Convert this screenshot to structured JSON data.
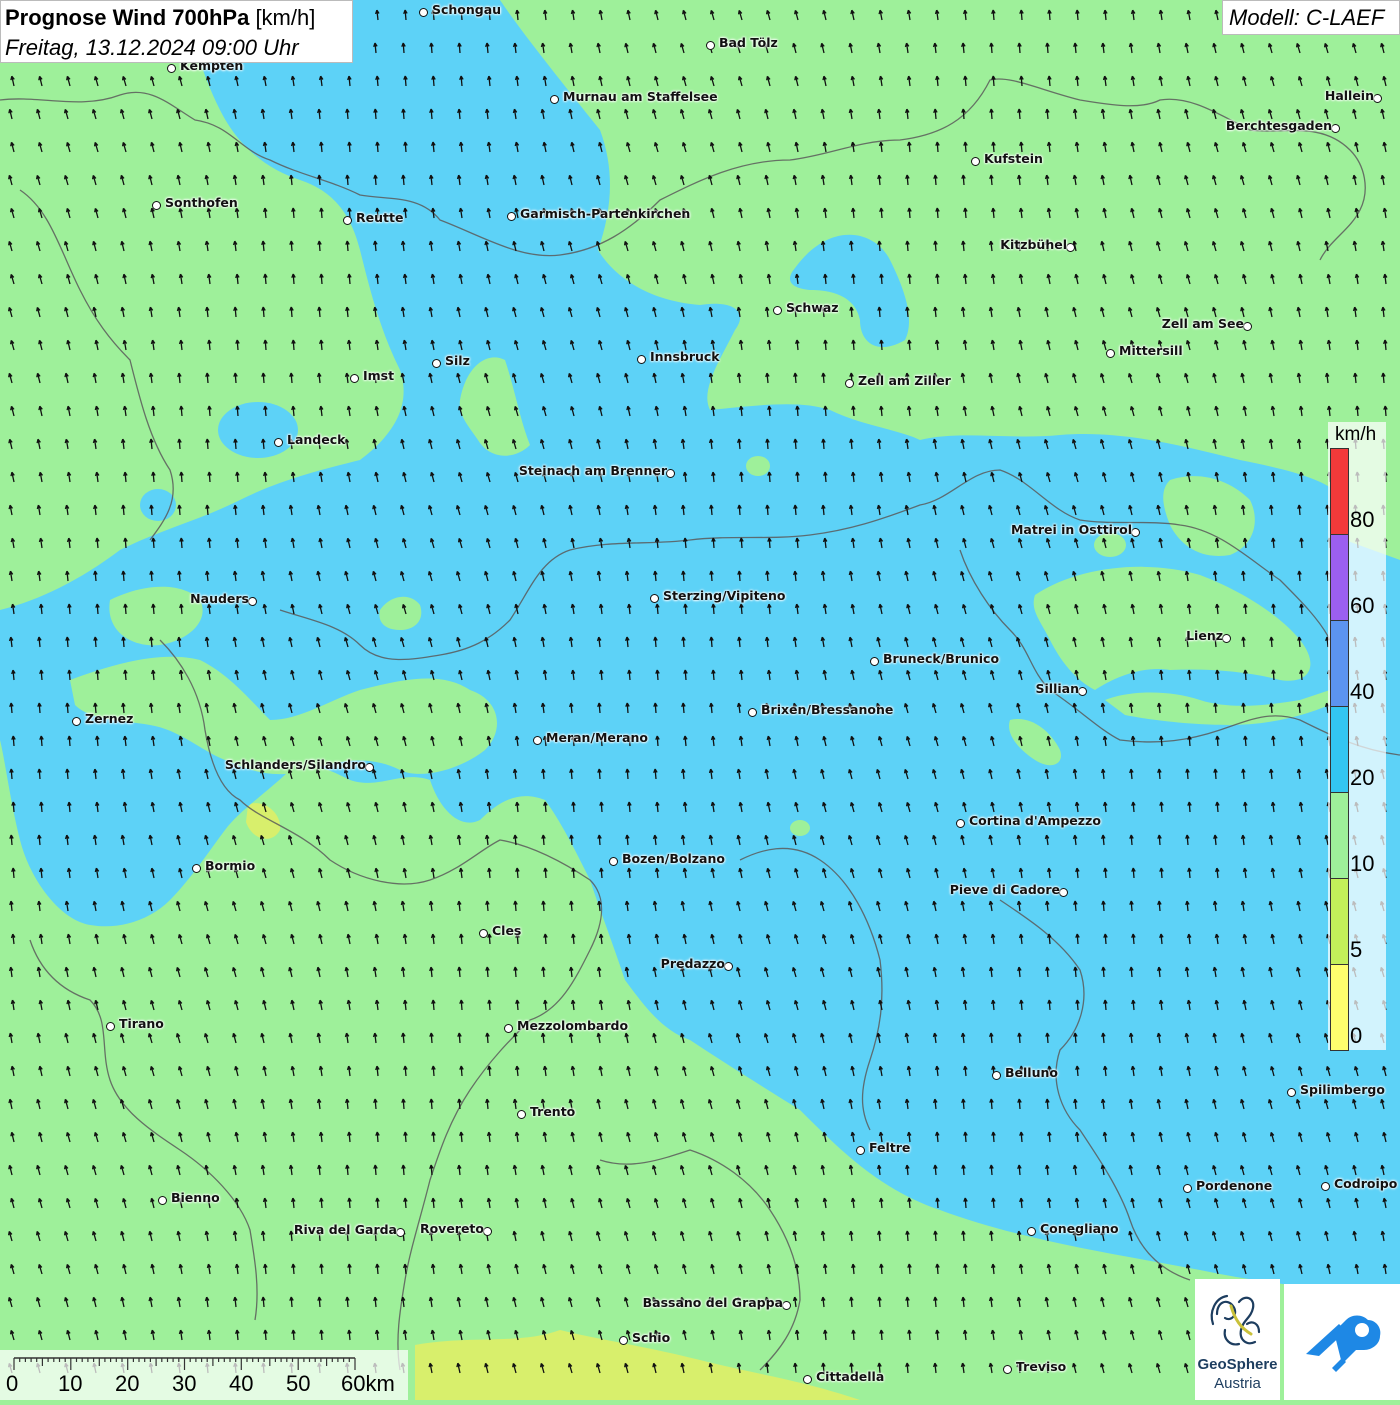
{
  "header": {
    "title_bold": "Prognose Wind 700hPa",
    "title_unit": "[km/h]",
    "date": "Freitag, 13.12.2024 09:00 Uhr",
    "model": "Modell: C-LAEF"
  },
  "legend": {
    "unit": "km/h",
    "labels": [
      "80",
      "60",
      "40",
      "20",
      "10",
      "5",
      "0"
    ],
    "colors": [
      "#f23a3a",
      "#9b5ff0",
      "#5c94f0",
      "#33c6f2",
      "#9ef09a",
      "#c3f05a",
      "#ffff6e"
    ]
  },
  "scale": {
    "labels": [
      "0",
      "10",
      "20",
      "30",
      "40",
      "50",
      "60km"
    ]
  },
  "colors": {
    "wind_10_20": "#9ef09a",
    "wind_20_40": "#5dd2f7",
    "wind_5_10": "#d8ef6c",
    "border": "#555555",
    "arrow": "#111111"
  },
  "cities": [
    {
      "name": "Schongau"
    },
    {
      "name": "Bad Tölz"
    },
    {
      "name": "Kempten"
    },
    {
      "name": "Hallein"
    },
    {
      "name": "Murnau am Staffelsee"
    },
    {
      "name": "Berchtesgaden"
    },
    {
      "name": "Kufstein"
    },
    {
      "name": "Sonthofen"
    },
    {
      "name": "Reutte"
    },
    {
      "name": "Garmisch-Partenkirchen"
    },
    {
      "name": "Kitzbühel"
    },
    {
      "name": "Schwaz"
    },
    {
      "name": "Zell am See"
    },
    {
      "name": "Mittersill"
    },
    {
      "name": "Innsbruck"
    },
    {
      "name": "Silz"
    },
    {
      "name": "Imst"
    },
    {
      "name": "Zell am Ziller"
    },
    {
      "name": "Landeck"
    },
    {
      "name": "Steinach am Brenner"
    },
    {
      "name": "Matrei in Osttirol"
    },
    {
      "name": "Nauders"
    },
    {
      "name": "Sterzing/Vipiteno"
    },
    {
      "name": "Lienz"
    },
    {
      "name": "Bruneck/Brunico"
    },
    {
      "name": "Sillian"
    },
    {
      "name": "Zernez"
    },
    {
      "name": "Brixen/Bressanone"
    },
    {
      "name": "Meran/Merano"
    },
    {
      "name": "Schlanders/Silandro"
    },
    {
      "name": "Cortina d'Ampezzo"
    },
    {
      "name": "Bozen/Bolzano"
    },
    {
      "name": "Bormio"
    },
    {
      "name": "Pieve di Cadore"
    },
    {
      "name": "Cles"
    },
    {
      "name": "Predazzo"
    },
    {
      "name": "Tirano"
    },
    {
      "name": "Mezzolombardo"
    },
    {
      "name": "Belluno"
    },
    {
      "name": "Spilimbergo"
    },
    {
      "name": "Trento"
    },
    {
      "name": "Feltre"
    },
    {
      "name": "Bienno"
    },
    {
      "name": "Pordenone"
    },
    {
      "name": "Codroipo"
    },
    {
      "name": "Riva del Garda"
    },
    {
      "name": "Rovereto"
    },
    {
      "name": "Conegliano"
    },
    {
      "name": "Bassano del Grappa"
    },
    {
      "name": "Schio"
    },
    {
      "name": "Treviso"
    },
    {
      "name": "Cittadella"
    }
  ],
  "logos": {
    "geosphere_name": "GeoSphere",
    "geosphere_sub": "Austria"
  }
}
